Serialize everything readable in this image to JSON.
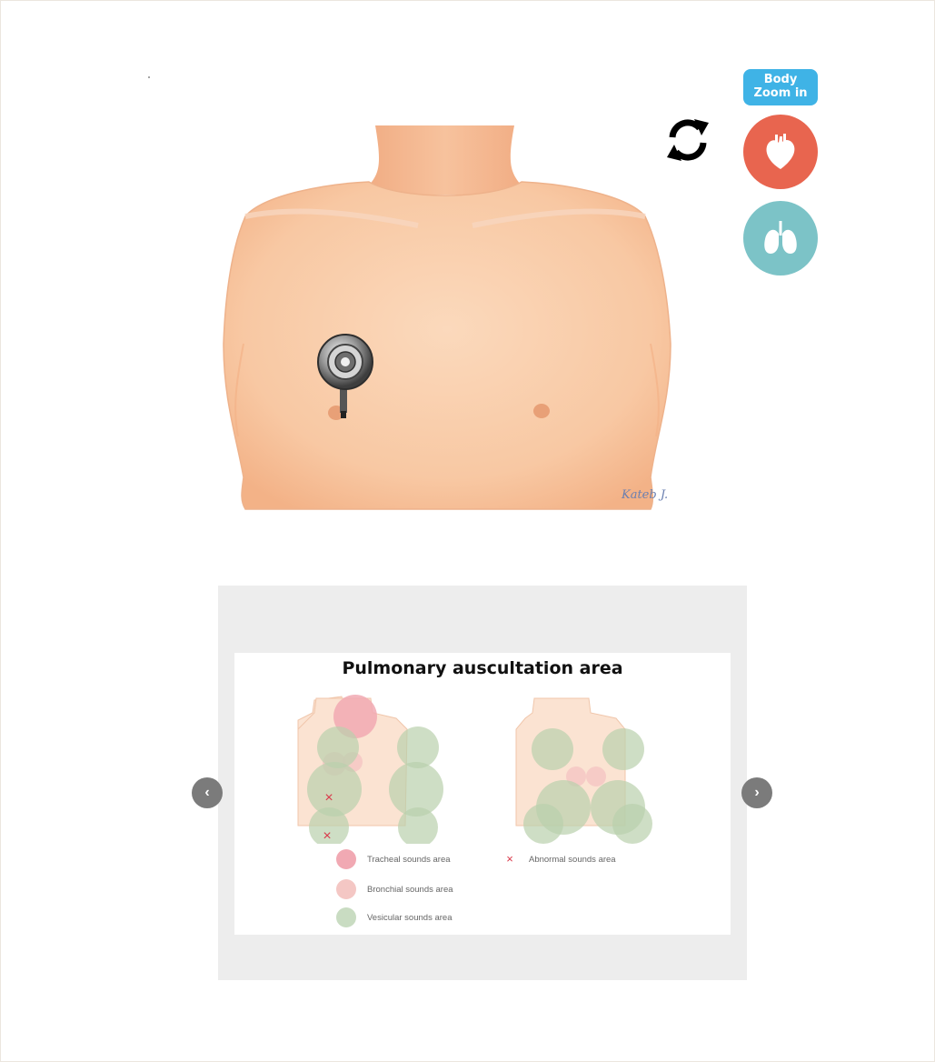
{
  "controls": {
    "zoom_line1": "Body",
    "zoom_line2": "Zoom in",
    "refresh_icon": "refresh-icon",
    "heart_icon": "heart-icon",
    "lungs_icon": "lungs-icon",
    "heart_color": "#e8654f",
    "lungs_color": "#7cc3c7",
    "zoom_color": "#3fb3e6"
  },
  "main_image": {
    "subject": "torso-illustration",
    "signature": "Kateb J."
  },
  "slider": {
    "title": "Pulmonary auscultation area",
    "prev_icon": "chevron-left-icon",
    "next_icon": "chevron-right-icon",
    "legend": [
      {
        "label": "Tracheal sounds area",
        "color": "#f1a9b3"
      },
      {
        "label": "Bronchial sounds area",
        "color": "#f4c7c4"
      },
      {
        "label": "Vesicular sounds area",
        "color": "#c9dcc2"
      },
      {
        "label": "Abnormal sounds area",
        "symbol": "×",
        "color": "#d9394a"
      }
    ]
  }
}
